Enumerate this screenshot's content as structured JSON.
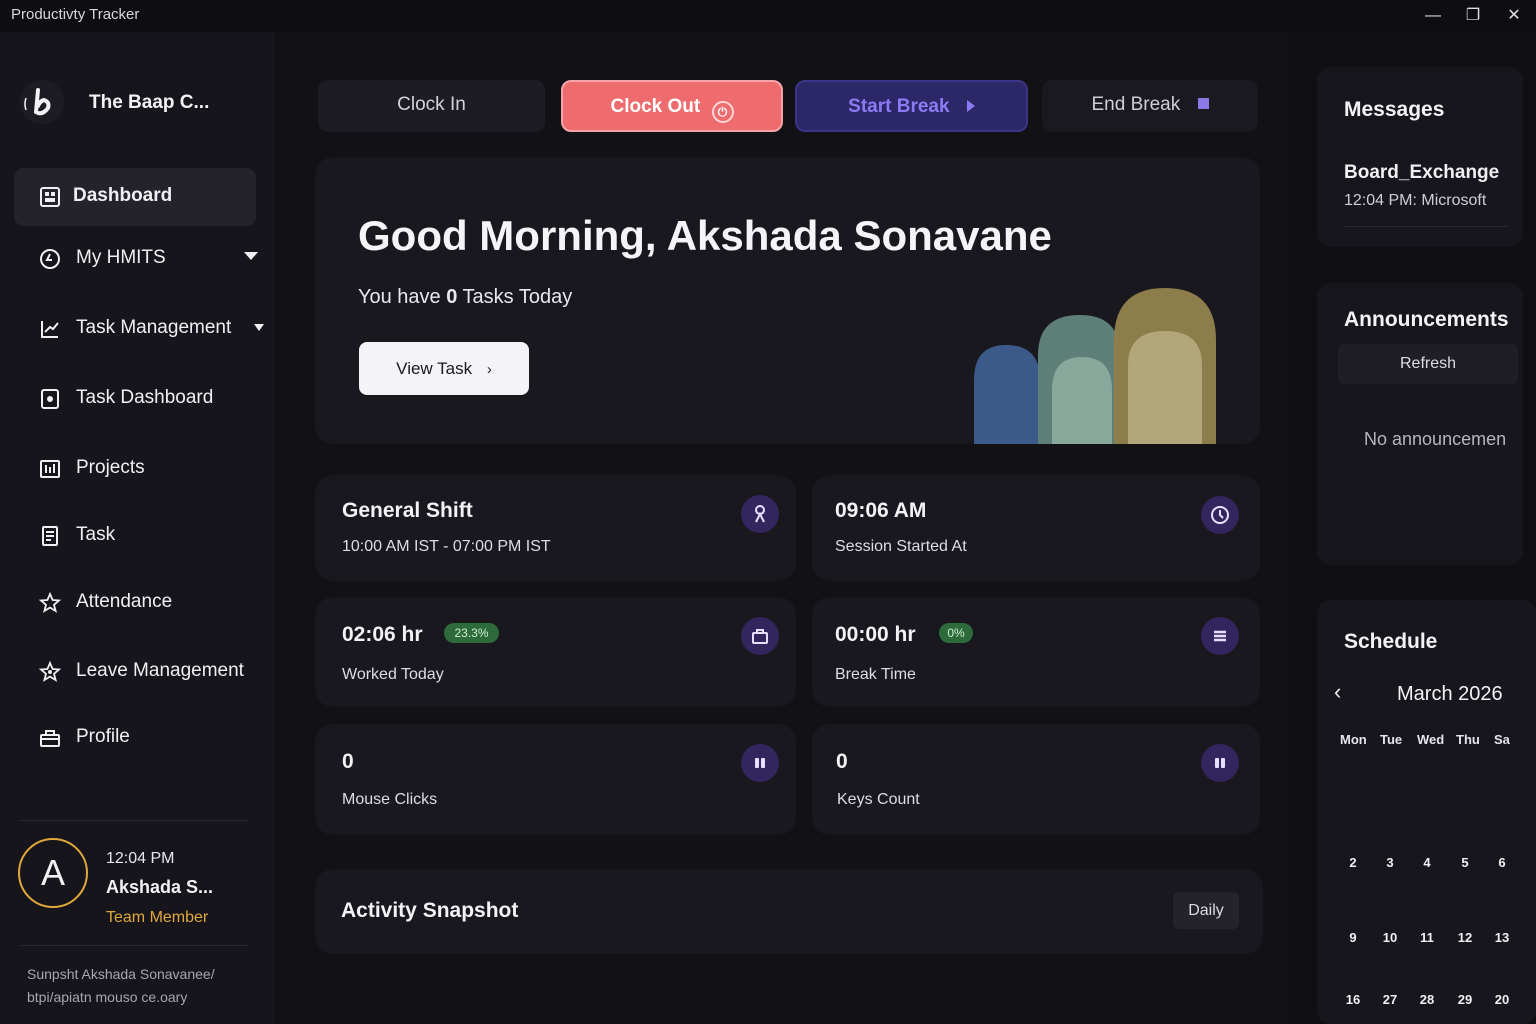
{
  "window": {
    "title": "Productivty Tracker"
  },
  "brand": {
    "name": "The Baap C..."
  },
  "nav": {
    "dashboard": "Dashboard",
    "my_hmits": "My HMITS",
    "task_management": "Task Management",
    "task_dashboard": "Task Dashboard",
    "projects": "Projects",
    "task": "Task",
    "attendance": "Attendance",
    "leave_management": "Leave Management",
    "profile": "Profile"
  },
  "user": {
    "initial": "A",
    "time": "12:04 PM",
    "name": "Akshada S...",
    "role": "Team Member",
    "footer_line1": "Sunpsht Akshada Sonavanee/",
    "footer_line2": "btpi/apiatn mouso ce.oary"
  },
  "actions": {
    "clock_in": "Clock In",
    "clock_out": "Clock Out",
    "start_break": "Start Break",
    "end_break": "End Break"
  },
  "hero": {
    "greeting": "Good Morning, Akshada Sonavane",
    "tasks_prefix": "You have ",
    "tasks_count": "0",
    "tasks_suffix": " Tasks Today",
    "view_task": "View Task"
  },
  "stats": {
    "shift_title": "General Shift",
    "shift_hours": "10:00 AM IST - 07:00 PM IST",
    "session_time": "09:06 AM",
    "session_label": "Session Started At",
    "worked_value": "02:06 hr",
    "worked_badge": "23.3%",
    "worked_label": "Worked Today",
    "break_value": "00:00 hr",
    "break_badge": "0%",
    "break_label": "Break Time",
    "mouse_value": "0",
    "mouse_label": "Mouse Clicks",
    "keys_value": "0",
    "keys_label": "Keys Count"
  },
  "activity": {
    "title": "Activity Snapshot",
    "range": "Daily"
  },
  "messages": {
    "title": "Messages",
    "item_title": "Board_Exchange",
    "item_sub": "12:04 PM: Microsoft"
  },
  "announcements": {
    "title": "Announcements",
    "refresh": "Refresh",
    "empty": "No announcemen"
  },
  "schedule": {
    "title": "Schedule",
    "month": "March 2026",
    "days": [
      "Mon",
      "Tue",
      "Wed",
      "Thu",
      "Sa"
    ],
    "week1": [
      "2",
      "3",
      "4",
      "5",
      "6"
    ],
    "week2": [
      "9",
      "10",
      "11",
      "12",
      "13"
    ],
    "week3": [
      "16",
      "27",
      "28",
      "29",
      "20"
    ]
  },
  "colors": {
    "accent_purple": "#7a5cf0",
    "clock_out": "#ee6b6e",
    "team_member": "#e0a83a",
    "badge_green": "#2d6b3a"
  }
}
